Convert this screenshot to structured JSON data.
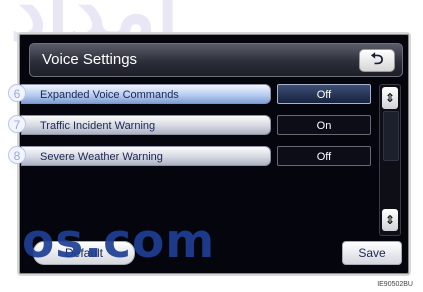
{
  "watermark_top": "امداد",
  "watermark_bottom": "os.com",
  "header": {
    "title": "Voice Settings",
    "back_icon": "return-arrow-icon",
    "back_glyph": "⮌"
  },
  "callouts": [
    {
      "number": "6"
    },
    {
      "number": "7"
    },
    {
      "number": "8"
    }
  ],
  "settings": [
    {
      "label": "Expanded Voice Commands",
      "value": "Off",
      "active": true
    },
    {
      "label": "Traffic Incident Warning",
      "value": "On",
      "active": false
    },
    {
      "label": "Severe Weather Warning",
      "value": "Off",
      "active": false
    }
  ],
  "scroll": {
    "up_glyph": "⇕",
    "down_glyph": "⇕"
  },
  "buttons": {
    "default_label": "Default",
    "save_label": "Save"
  },
  "image_code": "IE90502BU",
  "colors": {
    "screen_bg": "#05060d",
    "label_text": "#1c2754",
    "callout": "#9aa8d8",
    "watermark_blue": "#1e3f94"
  }
}
